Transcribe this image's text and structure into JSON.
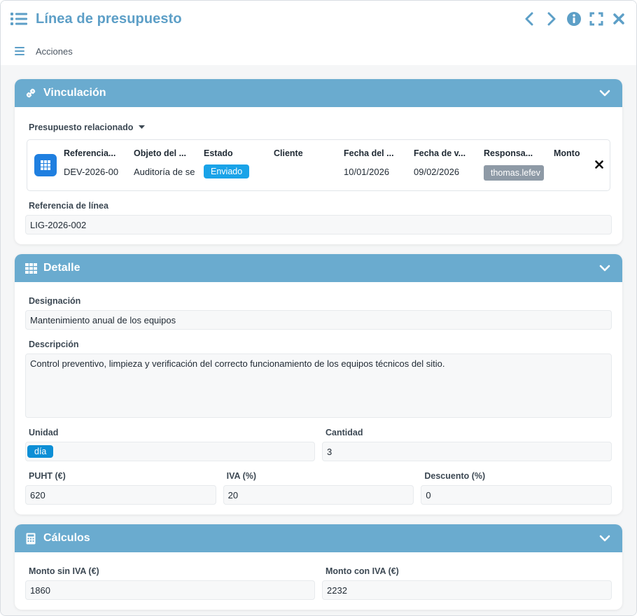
{
  "window": {
    "title": "Línea de presupuesto"
  },
  "menubar": {
    "label": "Acciones"
  },
  "panels": {
    "vinculacion": {
      "title": "Vinculación",
      "related_label": "Presupuesto relacionado",
      "columns": [
        "Referencia...",
        "Objeto del ...",
        "Estado",
        "Cliente",
        "Fecha del ...",
        "Fecha de v...",
        "Responsa...",
        "Monto"
      ],
      "record": {
        "referencia": "DEV-2026-00",
        "objeto": "Auditoría de se",
        "estado": "Enviado",
        "cliente": "",
        "fecha": "10/01/2026",
        "fecha_v": "09/02/2026",
        "responsable": "thomas.lefev",
        "monto": ""
      },
      "line_ref_label": "Referencia de línea",
      "line_ref_value": "LIG-2026-002"
    },
    "detalle": {
      "title": "Detalle",
      "designacion_label": "Designación",
      "designacion_value": "Mantenimiento anual de los equipos",
      "descripcion_label": "Descripción",
      "descripcion_value": "Control preventivo, limpieza y verificación del correcto funcionamiento de los equipos técnicos del sitio.",
      "unidad_label": "Unidad",
      "unidad_value": "día",
      "cantidad_label": "Cantidad",
      "cantidad_value": "3",
      "puht_label": "PUHT (€)",
      "puht_value": "620",
      "iva_label": "IVA (%)",
      "iva_value": "20",
      "descuento_label": "Descuento (%)",
      "descuento_value": "0"
    },
    "calculos": {
      "title": "Cálculos",
      "sin_iva_label": "Monto sin IVA (€)",
      "sin_iva_value": "1860",
      "con_iva_label": "Monto con IVA (€)",
      "con_iva_value": "2232"
    }
  },
  "colors": {
    "accent": "#5d9fc7",
    "panel_header": "#6aabcf",
    "badge_sent": "#1aa3e8",
    "badge_user": "#8e9aa6",
    "unit_tag": "#0d8fd6",
    "grid_button": "#1f7fe0"
  },
  "icons": {
    "title": "list-icon",
    "prev": "chevron-left-icon",
    "next": "chevron-right-icon",
    "info": "info-icon",
    "expand": "expand-icon",
    "close": "close-icon",
    "menu": "hamburger-icon",
    "link": "link-icon",
    "table": "table-icon",
    "calculator": "calculator-icon",
    "collapse": "chevron-down-icon",
    "remove": "remove-icon"
  }
}
